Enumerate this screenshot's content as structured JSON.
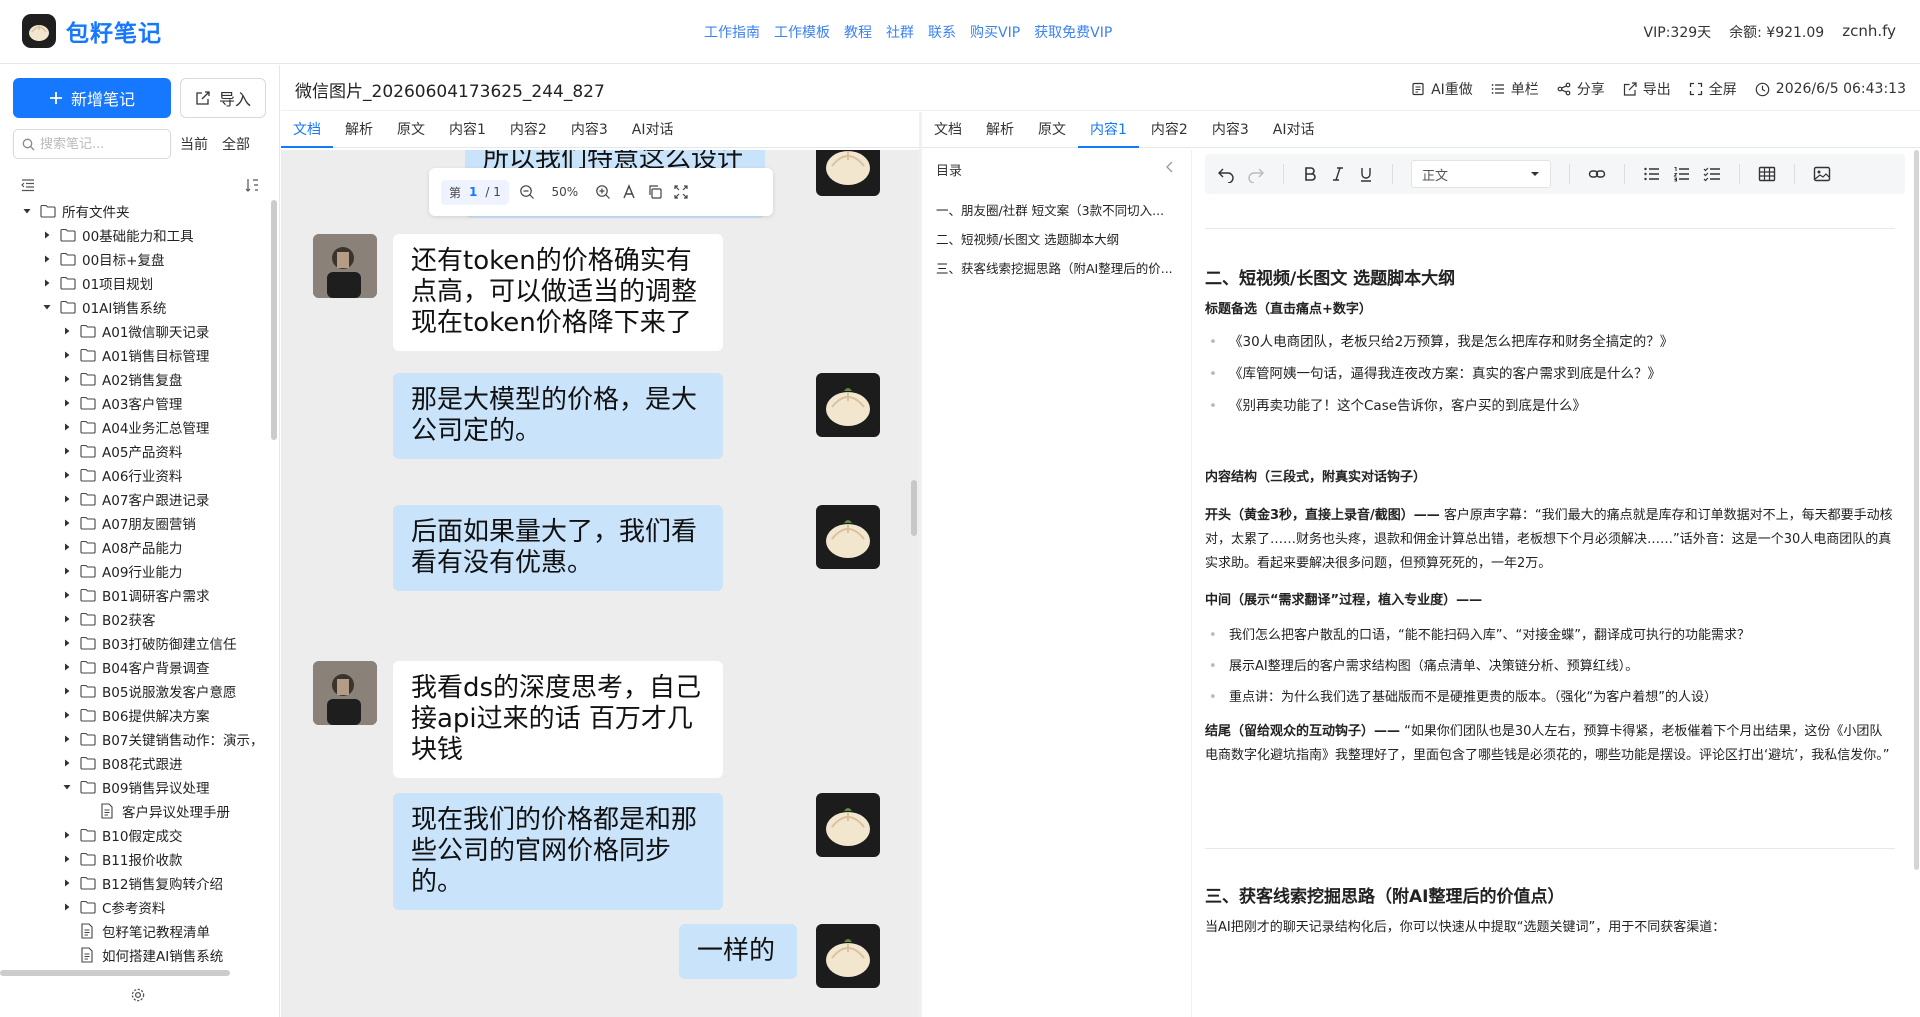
{
  "app": {
    "name": "包籽笔记"
  },
  "topnav": [
    "工作指南",
    "工作模板",
    "教程",
    "社群",
    "联系",
    "购买VIP",
    "获取免费VIP"
  ],
  "account": {
    "vip": "VIP:329天",
    "balance": "余额: ¥921.09",
    "user": "zcnh.fy"
  },
  "sidebar": {
    "new_note": "新增笔记",
    "import": "导入",
    "search_placeholder": "搜索笔记...",
    "scope_current": "当前",
    "scope_all": "全部",
    "tree": [
      {
        "label": "所有文件夹",
        "depth": 0,
        "type": "folder",
        "expanded": true
      },
      {
        "label": "00基础能力和工具",
        "depth": 1,
        "type": "folder",
        "expanded": false
      },
      {
        "label": "00目标+复盘",
        "depth": 1,
        "type": "folder",
        "expanded": false
      },
      {
        "label": "01项目规划",
        "depth": 1,
        "type": "folder",
        "expanded": false
      },
      {
        "label": "01AI销售系统",
        "depth": 1,
        "type": "folder",
        "expanded": true
      },
      {
        "label": "A01微信聊天记录",
        "depth": 2,
        "type": "folder",
        "expanded": false
      },
      {
        "label": "A01销售目标管理",
        "depth": 2,
        "type": "folder",
        "expanded": false
      },
      {
        "label": "A02销售复盘",
        "depth": 2,
        "type": "folder",
        "expanded": false
      },
      {
        "label": "A03客户管理",
        "depth": 2,
        "type": "folder",
        "expanded": false
      },
      {
        "label": "A04业务汇总管理",
        "depth": 2,
        "type": "folder",
        "expanded": false
      },
      {
        "label": "A05产品资料",
        "depth": 2,
        "type": "folder",
        "expanded": false
      },
      {
        "label": "A06行业资料",
        "depth": 2,
        "type": "folder",
        "expanded": false
      },
      {
        "label": "A07客户跟进记录",
        "depth": 2,
        "type": "folder",
        "expanded": false
      },
      {
        "label": "A07朋友圈营销",
        "depth": 2,
        "type": "folder",
        "expanded": false
      },
      {
        "label": "A08产品能力",
        "depth": 2,
        "type": "folder",
        "expanded": false
      },
      {
        "label": "A09行业能力",
        "depth": 2,
        "type": "folder",
        "expanded": false
      },
      {
        "label": "B01调研客户需求",
        "depth": 2,
        "type": "folder",
        "expanded": false
      },
      {
        "label": "B02获客",
        "depth": 2,
        "type": "folder",
        "expanded": false
      },
      {
        "label": "B03打破防御建立信任",
        "depth": 2,
        "type": "folder",
        "expanded": false
      },
      {
        "label": "B04客户背景调查",
        "depth": 2,
        "type": "folder",
        "expanded": false
      },
      {
        "label": "B05说服激发客户意愿",
        "depth": 2,
        "type": "folder",
        "expanded": false
      },
      {
        "label": "B06提供解决方案",
        "depth": 2,
        "type": "folder",
        "expanded": false
      },
      {
        "label": "B07关键销售动作：演示，",
        "depth": 2,
        "type": "folder",
        "expanded": false
      },
      {
        "label": "B08花式跟进",
        "depth": 2,
        "type": "folder",
        "expanded": false
      },
      {
        "label": "B09销售异议处理",
        "depth": 2,
        "type": "folder",
        "expanded": true
      },
      {
        "label": "客户异议处理手册",
        "depth": 3,
        "type": "file",
        "expanded": false
      },
      {
        "label": "B10假定成交",
        "depth": 2,
        "type": "folder",
        "expanded": false
      },
      {
        "label": "B11报价收款",
        "depth": 2,
        "type": "folder",
        "expanded": false
      },
      {
        "label": "B12销售复购转介绍",
        "depth": 2,
        "type": "folder",
        "expanded": false
      },
      {
        "label": "C参考资料",
        "depth": 2,
        "type": "folder",
        "expanded": false
      },
      {
        "label": "包籽笔记教程清单",
        "depth": 2,
        "type": "file",
        "expanded": false
      },
      {
        "label": "如何搭建AI销售系统",
        "depth": 2,
        "type": "file",
        "expanded": false
      }
    ]
  },
  "doc": {
    "title": "微信图片_20260604173625_244_827",
    "actions": {
      "ai_redo": "AI重做",
      "single": "单栏",
      "share": "分享",
      "export": "导出",
      "fullscreen": "全屏",
      "datetime": "2026/6/5 06:43:13"
    }
  },
  "left_tabs": [
    "文档",
    "解析",
    "原文",
    "内容1",
    "内容2",
    "内容3",
    "AI对话"
  ],
  "right_tabs": [
    "文档",
    "解析",
    "原文",
    "内容1",
    "内容2",
    "内容3",
    "AI对话"
  ],
  "viewer": {
    "page_prefix": "第",
    "page_current": "1",
    "page_total": "/ 1",
    "zoom": "50%",
    "messages": [
      {
        "from": "me",
        "text": "所以我们特意这么设计的"
      },
      {
        "from": "other",
        "text": "还有token的价格确实有点高，可以做适当的调整 现在token价格降下来了"
      },
      {
        "from": "me",
        "text": "那是大模型的价格，是大公司定的。"
      },
      {
        "from": "me",
        "text": "后面如果量大了，我们看看有没有优惠。"
      },
      {
        "from": "other",
        "text": "我看ds的深度思考，自己接api过来的话 百万才几块钱"
      },
      {
        "from": "me",
        "text": "现在我们的价格都是和那些公司的官网价格同步的。"
      },
      {
        "from": "me",
        "text": "一样的"
      }
    ]
  },
  "toc": {
    "title": "目录",
    "items": [
      "一、朋友圈/社群 短文案（3款不同切入...",
      "二、短视频/长图文 选题脚本大纲",
      "三、获客线索挖掘思路（附AI整理后的价..."
    ]
  },
  "editor": {
    "style": "正文",
    "h2": "二、短视频/长图文 选题脚本大纲",
    "title_label": "标题备选（直击痛点+数字）",
    "titles": [
      "《30人电商团队，老板只给2万预算，我是怎么把库存和财务全搞定的？》",
      "《库管阿姨一句话，逼得我连夜改方案：真实的客户需求到底是什么？》",
      "《别再卖功能了！这个Case告诉你，客户买的到底是什么》"
    ],
    "structure_label": "内容结构（三段式，附真实对话钩子）",
    "open_label": "开头（黄金3秒，直接上录音/截图）——",
    "open_text": " 客户原声字幕：“我们最大的痛点就是库存和订单数据对不上，每天都要手动核对，太累了……财务也头疼，退款和佣金计算总出错，老板想下个月必须解决……”话外音：这是一个30人电商团队的真实求助。看起来要解决很多问题，但预算死死的，一年2万。",
    "middle_label": "中间（展示“需求翻译”过程，植入专业度）——",
    "middle_items": [
      "我们怎么把客户散乱的口语，“能不能扫码入库”、“对接金蝶”，翻译成可执行的功能需求？",
      "展示AI整理后的客户需求结构图（痛点清单、决策链分析、预算红线）。",
      "重点讲：为什么我们选了基础版而不是硬推更贵的版本。（强化“为客户着想”的人设）"
    ],
    "end_label": "结尾（留给观众的互动钩子）——",
    "end_text": " “如果你们团队也是30人左右，预算卡得紧，老板催着下个月出结果，这份《小团队电商数字化避坑指南》我整理好了，里面包含了哪些钱是必须花的，哪些功能是摆设。评论区打出‘避坑’，我私信发你。”",
    "h3": "三、获客线索挖掘思路（附AI整理后的价值点）",
    "tail": "当AI把刚才的聊天记录结构化后，你可以快速从中提取“选题关键词”，用于不同获客渠道："
  },
  "colors": {
    "accent": "#1677ff",
    "bubble_me": "#c9e3fb",
    "viewer_bg": "#ededed"
  }
}
